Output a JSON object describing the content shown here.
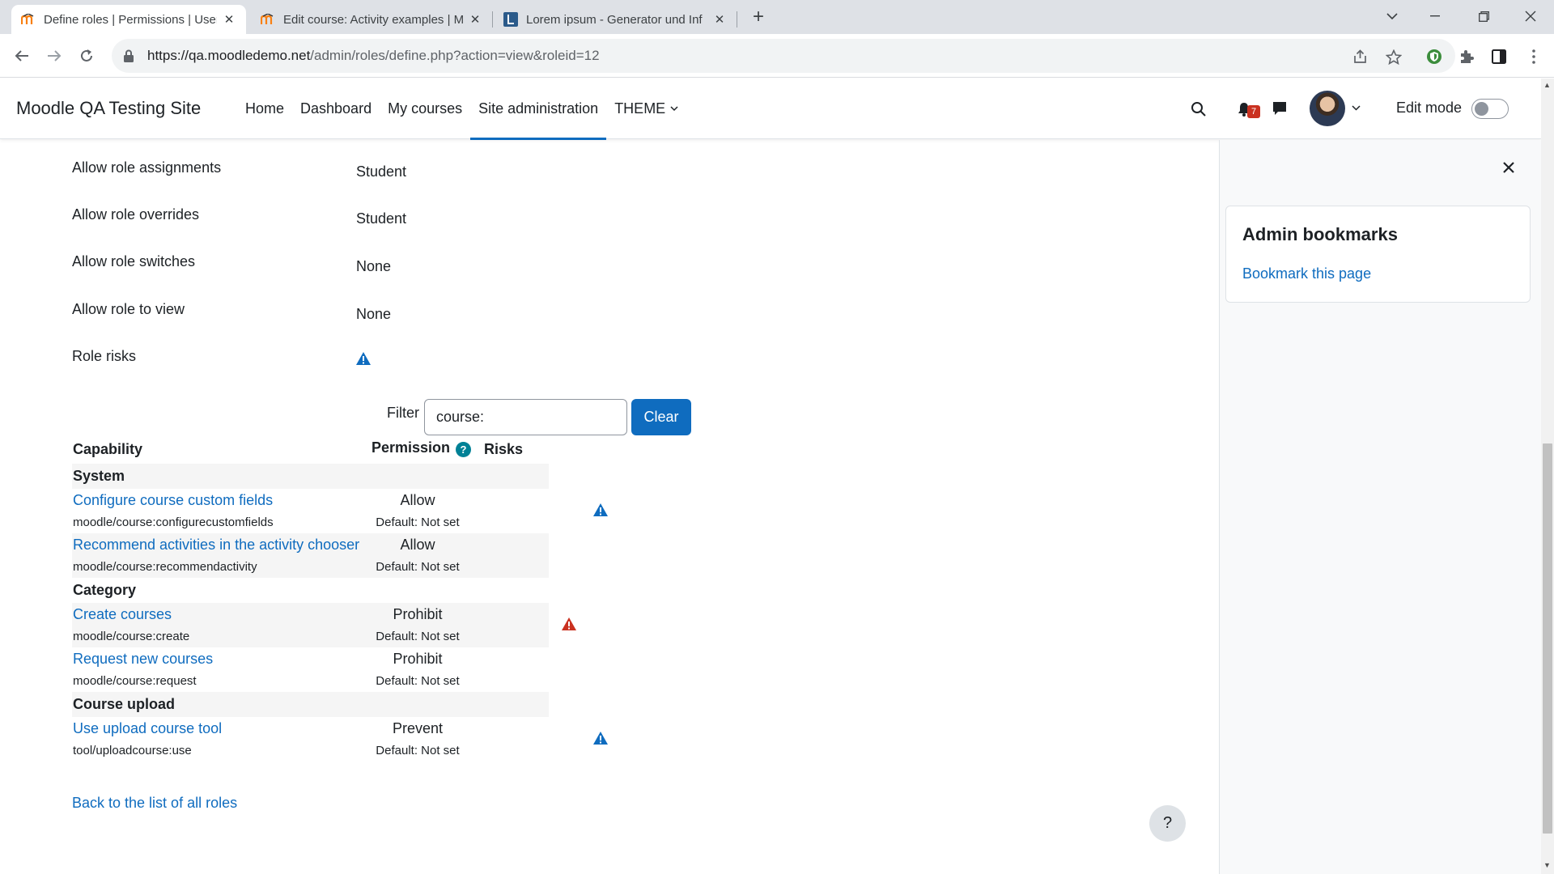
{
  "browser": {
    "tabs": [
      {
        "title": "Define roles | Permissions | Users",
        "icon": "moodle-icon",
        "active": true
      },
      {
        "title": "Edit course: Activity examples | M",
        "icon": "moodle-icon",
        "active": false
      },
      {
        "title": "Lorem ipsum - Generator und Inf",
        "icon": "lorem-ipsum-icon",
        "active": false
      }
    ],
    "url_host": "https://qa.moodledemo.net",
    "url_path": "/admin/roles/define.php?action=view&roleid=12"
  },
  "site": {
    "brand": "Moodle QA Testing Site",
    "nav": [
      {
        "label": "Home"
      },
      {
        "label": "Dashboard"
      },
      {
        "label": "My courses"
      },
      {
        "label": "Site administration",
        "active": true
      },
      {
        "label": "THEME",
        "dropdown": true
      }
    ],
    "notification_count": "7",
    "edit_mode_label": "Edit mode",
    "edit_mode_on": false
  },
  "role_settings": [
    {
      "label": "Allow role assignments",
      "value": "Student"
    },
    {
      "label": "Allow role overrides",
      "value": "Student"
    },
    {
      "label": "Allow role switches",
      "value": "None"
    },
    {
      "label": "Allow role to view",
      "value": "None"
    },
    {
      "label": "Role risks",
      "value": ""
    }
  ],
  "filter": {
    "label": "Filter",
    "value": "course:",
    "clear_label": "Clear"
  },
  "table": {
    "headers": {
      "capability": "Capability",
      "permission": "Permission",
      "risks": "Risks"
    },
    "groups": [
      {
        "title": "System",
        "rows": [
          {
            "name": "Configure course custom fields",
            "id": "moodle/course:configurecustomfields",
            "permission": "Allow",
            "default": "Default: Not set",
            "risks": [
              "config"
            ]
          },
          {
            "name": "Recommend activities in the activity chooser",
            "id": "moodle/course:recommendactivity",
            "permission": "Allow",
            "default": "Default: Not set",
            "risks": []
          }
        ]
      },
      {
        "title": "Category",
        "rows": [
          {
            "name": "Create courses",
            "id": "moodle/course:create",
            "permission": "Prohibit",
            "default": "Default: Not set",
            "risks": [
              "xss"
            ]
          },
          {
            "name": "Request new courses",
            "id": "moodle/course:request",
            "permission": "Prohibit",
            "default": "Default: Not set",
            "risks": []
          }
        ]
      },
      {
        "title": "Course upload",
        "rows": [
          {
            "name": "Use upload course tool",
            "id": "tool/uploadcourse:use",
            "permission": "Prevent",
            "default": "Default: Not set",
            "risks": [
              "config"
            ]
          }
        ]
      }
    ]
  },
  "back_link": "Back to the list of all roles",
  "drawer": {
    "block_title": "Admin bookmarks",
    "block_link": "Bookmark this page"
  },
  "help_button": "?",
  "colors": {
    "link": "#0f6cbf",
    "risk_blue": "#0f6cbf",
    "risk_red": "#ca3120",
    "help_teal": "#008196"
  }
}
